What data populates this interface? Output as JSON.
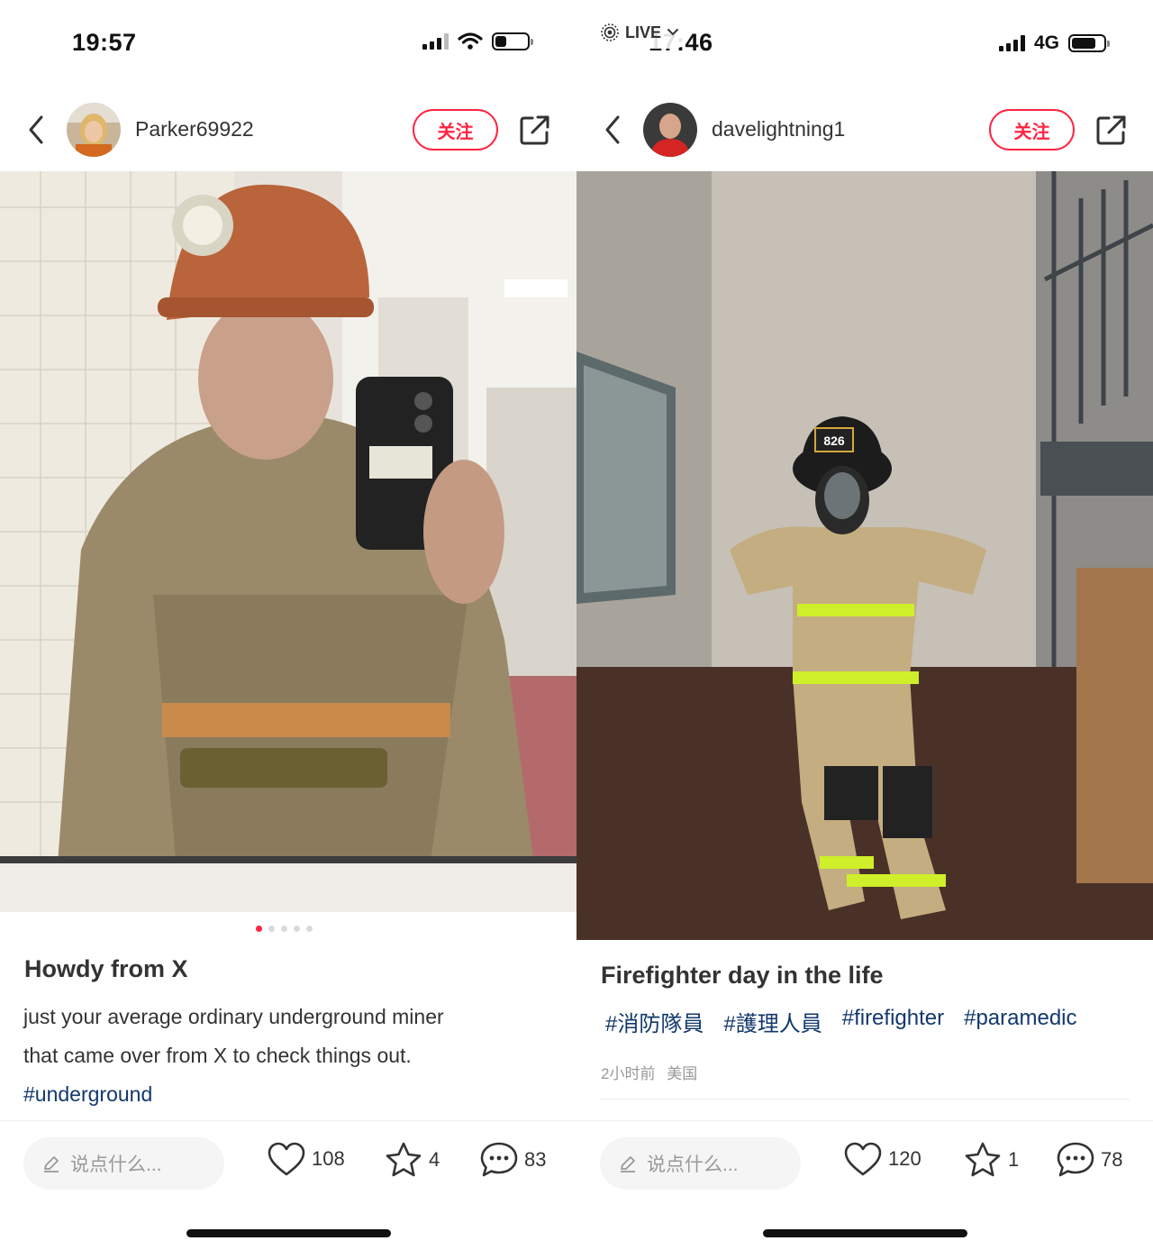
{
  "left": {
    "status": {
      "time": "19:57"
    },
    "header": {
      "username": "Parker69922",
      "follow_label": "关注"
    },
    "carousel": {
      "total": 5,
      "active": 1
    },
    "post": {
      "title": "Howdy from X",
      "body_line1": "just your average ordinary underground miner",
      "body_line2": "that came over from X to check things out.",
      "hashtag": "#underground"
    },
    "bottom": {
      "comment_placeholder": "说点什么...",
      "likes": "108",
      "stars": "4",
      "comments": "83"
    }
  },
  "right": {
    "status": {
      "time": "17:46",
      "network": "4G"
    },
    "header": {
      "username": "davelightning1",
      "follow_label": "关注"
    },
    "live_label": "LIVE",
    "helmet_number": "826",
    "post": {
      "title": "Firefighter day in the life",
      "tags": [
        "#消防隊員",
        "#護理人員",
        "#firefighter",
        "#paramedic"
      ],
      "meta_time": "2小时前",
      "meta_location": "美国"
    },
    "bottom": {
      "comment_placeholder": "说点什么...",
      "likes": "120",
      "stars": "1",
      "comments": "78"
    }
  },
  "colors": {
    "accent": "#ff2442",
    "hashtag": "#13386c",
    "muted": "#999999"
  }
}
